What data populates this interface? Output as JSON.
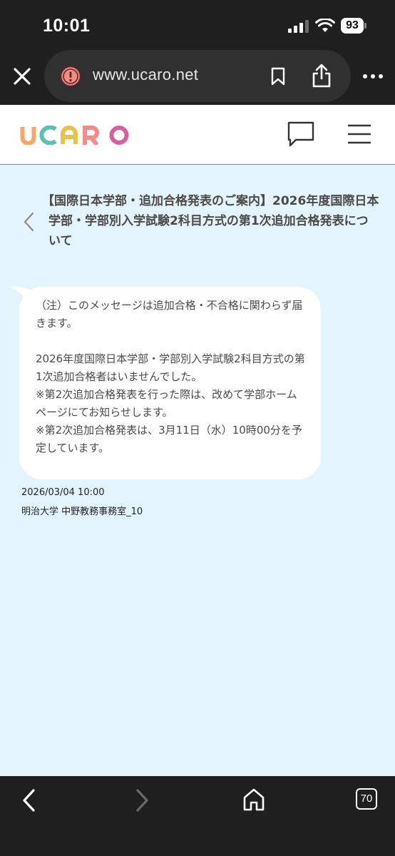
{
  "status_bar": {
    "time": "10:01",
    "battery": "93"
  },
  "browser": {
    "url": "www.ucaro.net",
    "tab_count": "70",
    "icons": {
      "close": "close-icon",
      "security": "warning-icon",
      "bookmark": "bookmark-icon",
      "share": "share-icon",
      "more": "more-icon",
      "back": "chevron-left-icon",
      "forward": "chevron-right-icon",
      "home": "home-icon",
      "tabs": "tabs-icon"
    }
  },
  "site": {
    "logo": "UCARO",
    "logo_colors": [
      "#f2a967",
      "#5fbfb1",
      "#e8c24a",
      "#f08c8c",
      "#d6609d"
    ],
    "icons": {
      "message": "chat-bubble-icon",
      "menu": "hamburger-icon"
    }
  },
  "message": {
    "title": "【国際日本学部・追加合格発表のご案内】2026年度国際日本学部・学部別入学試験2科目方式の第1次追加合格発表について",
    "body": "（注）このメッセージは追加合格・不合格に関わらず届きます。\n\n2026年度国際日本学部・学部別入学試験2科目方式の第1次追加合格者はいませんでした。\n※第2次追加合格発表を行った際は、改めて学部ホームページにてお知らせします。\n※第2次追加合格発表は、3月11日（水）10時00分を予定しています。",
    "date": "2026/03/04 10:00",
    "sender": "明治大学 中野教務事務室_10"
  },
  "colors": {
    "chrome_dark": "#1f1f1f",
    "url_pill": "#303030",
    "page_background": "#e4f4fd",
    "bubble": "#ffffff",
    "warning_red": "#f28b82"
  }
}
